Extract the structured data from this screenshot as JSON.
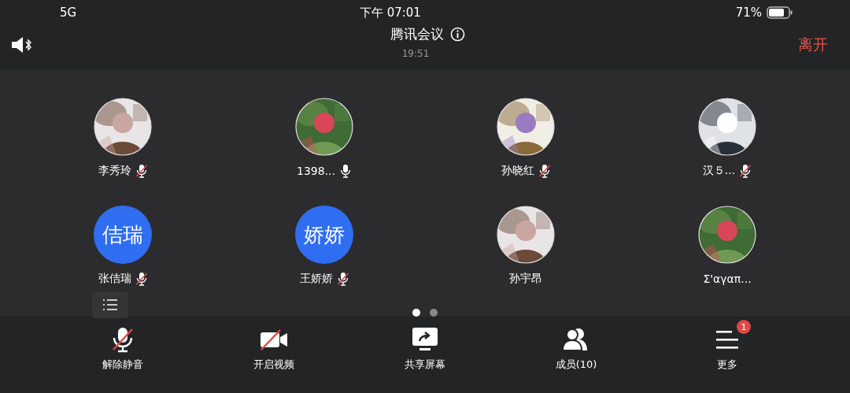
{
  "status_bar": {
    "network": "5G",
    "time": "下午 07:01",
    "battery": "71%"
  },
  "header": {
    "title": "腾讯会议",
    "duration": "19:51",
    "leave": "离开"
  },
  "participants": [
    {
      "name": "李秀玲",
      "mic": {
        "muted": true
      }
    },
    {
      "name": "1398...",
      "mic": {
        "muted": false
      }
    },
    {
      "name": "孙晓红",
      "mic": {
        "muted": true
      }
    },
    {
      "name": "汉５...",
      "mic": {
        "muted": true
      }
    },
    {
      "name": "张佶瑞",
      "avatar": {
        "kind": "initials",
        "text": "佶瑞"
      },
      "mic": {
        "muted": true
      }
    },
    {
      "name": "王娇娇",
      "avatar": {
        "kind": "initials",
        "text": "娇娇"
      },
      "mic": {
        "muted": true
      }
    },
    {
      "name": "孙宇昂"
    },
    {
      "name": "Σ'αγαπ..."
    }
  ],
  "pages": [
    {
      "selected": true
    },
    {
      "selected": false
    }
  ],
  "toolbar": [
    {
      "kind": "unmute",
      "label": "解除静音"
    },
    {
      "kind": "video",
      "label": "开启视频"
    },
    {
      "kind": "share",
      "label": "共享屏幕"
    },
    {
      "kind": "members",
      "label": "成员(10)"
    },
    {
      "kind": "more",
      "label": "更多",
      "badge": "1"
    }
  ]
}
